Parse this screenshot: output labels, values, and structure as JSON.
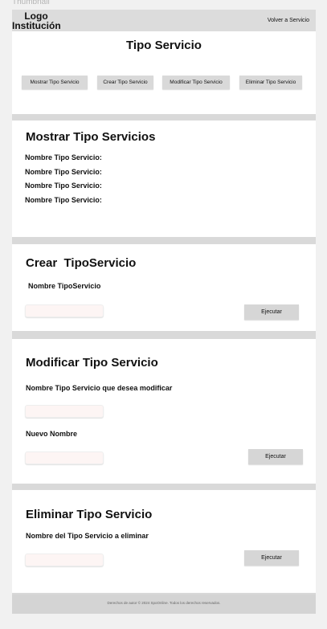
{
  "thumbnail_label": "Thumbnail",
  "header": {
    "logo_line1": "Logo",
    "logo_line2": "Institución",
    "back_link": "Volver a Servicio"
  },
  "intro": {
    "title": "Tipo Servicio",
    "buttons": [
      "Mostrar Tipo Servicio",
      "Crear Tipo Servicio",
      "Modificar Tipo Servicio",
      "Eliminar Tipo Servicio"
    ]
  },
  "mostrar": {
    "title": "Mostrar Tipo Servicios",
    "rows": [
      "Nombre Tipo Servicio:",
      "Nombre Tipo Servicio:",
      "Nombre Tipo Servicio:",
      "Nombre Tipo Servicio:"
    ]
  },
  "crear": {
    "title": "Crear  TipoServicio",
    "field_label": "Nombre TipoServicio",
    "input_value": "",
    "execute_label": "Ejecutar"
  },
  "modificar": {
    "title": "Modificar Tipo Servicio",
    "field_label": "Nombre Tipo Servicio que desea modificar",
    "input_value": "",
    "new_name_label": "Nuevo Nombre",
    "new_name_value": "",
    "execute_label": "Ejecutar"
  },
  "eliminar": {
    "title": "Eliminar Tipo Servicio",
    "field_label": "Nombre del Tipo Servicio a eliminar",
    "input_value": "",
    "execute_label": "Ejecutar"
  },
  "footer": {
    "text": "Derechos de autor © 2024 SpoOnline. Todos los derechos reservados."
  }
}
